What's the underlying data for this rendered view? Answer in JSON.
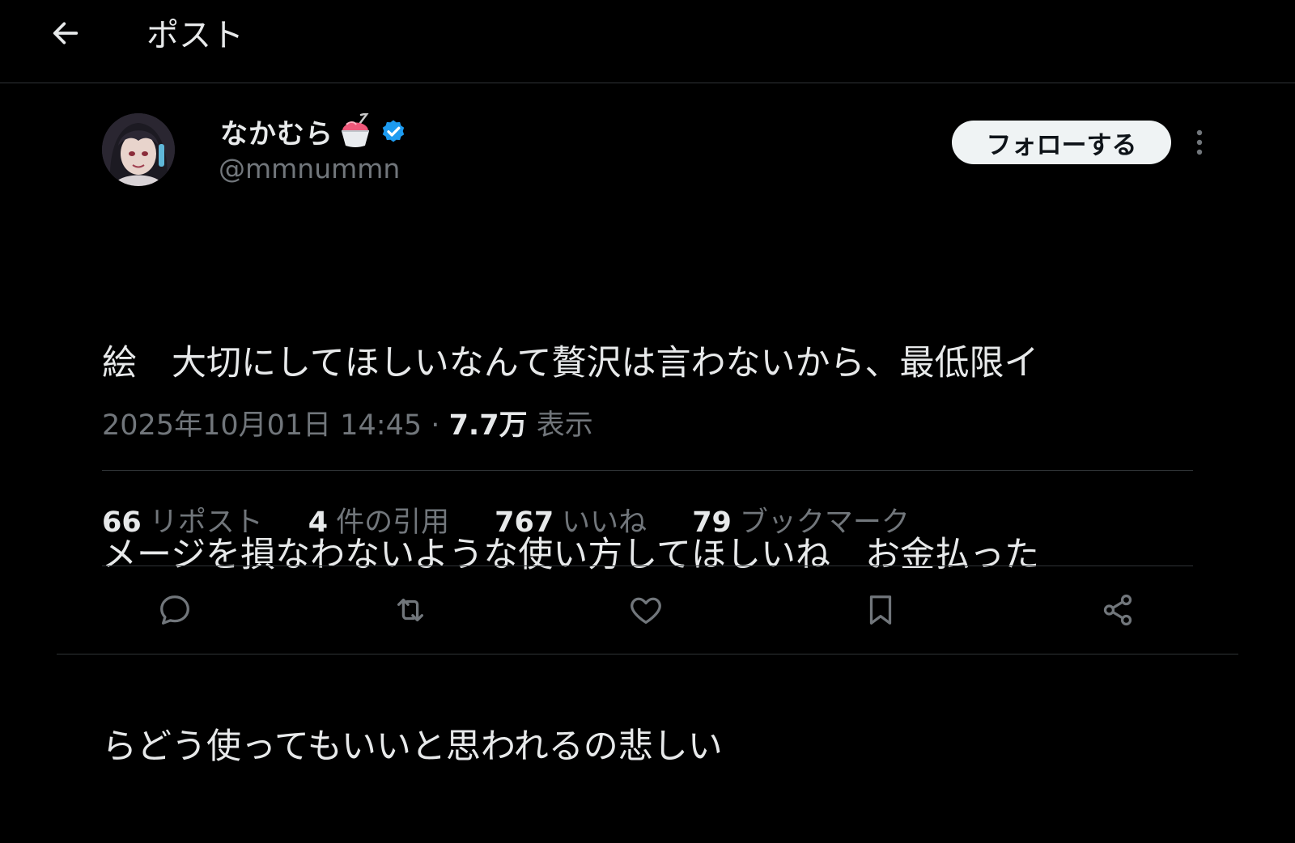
{
  "header": {
    "back_icon": "arrow-left-icon",
    "title": "ポスト"
  },
  "author": {
    "avatar_icon": "avatar-anime-girl",
    "display_name": "なかむら",
    "name_emoji_icon": "shaved-ice-icon",
    "verified_icon": "verified-badge-icon",
    "verified_color": "#1d9bf0",
    "handle": "@mmnummn",
    "follow_label": "フォローする",
    "more_icon": "more-vertical-icon"
  },
  "post": {
    "text_lines": [
      "絵　大切にしてほしいなんて贅沢は言わないから、最低限イ",
      "メージを損なわないような使い方してほしいね　お金払った",
      "らどう使ってもいいと思われるの悲しい"
    ],
    "timestamp": "2025年10月01日 14:45",
    "separator": "·",
    "views_count": "7.7万",
    "views_label": "表示"
  },
  "stats": [
    {
      "count": "66",
      "label": "リポスト"
    },
    {
      "count": "4",
      "label": "件の引用"
    },
    {
      "count": "767",
      "label": "いいね"
    },
    {
      "count": "79",
      "label": "ブックマーク"
    }
  ],
  "actions": [
    {
      "icon": "reply-icon"
    },
    {
      "icon": "repost-icon"
    },
    {
      "icon": "like-icon"
    },
    {
      "icon": "bookmark-icon"
    },
    {
      "icon": "share-icon"
    }
  ],
  "colors": {
    "background": "#000000",
    "primary_text": "#e7e9ea",
    "secondary_text": "#71767b",
    "divider": "#2f3336",
    "follow_bg": "#eff3f4"
  }
}
